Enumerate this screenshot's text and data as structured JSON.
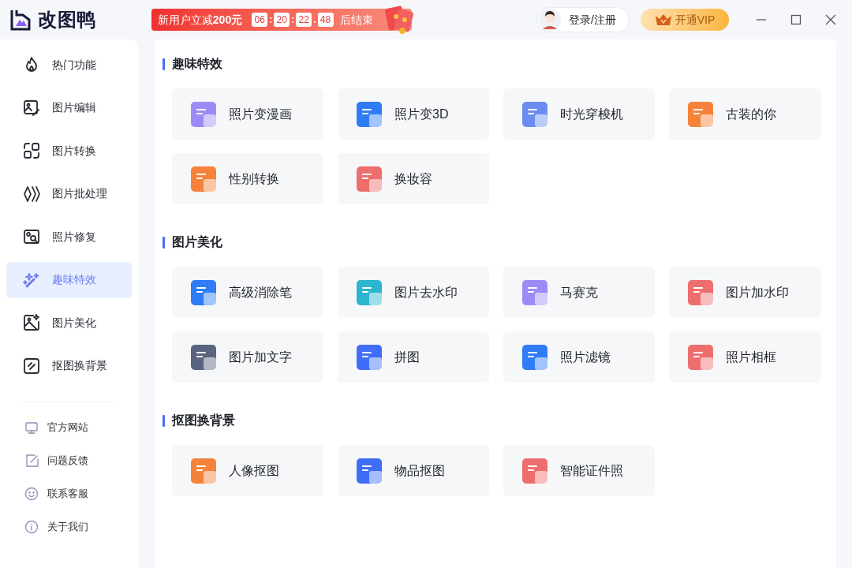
{
  "app": {
    "name": "改图鸭"
  },
  "promo": {
    "text": "新用户立减**200元**",
    "countdown": [
      "06",
      "20",
      "22",
      "48"
    ],
    "separators": [
      ":",
      ":",
      "."
    ],
    "suffix": "后结束"
  },
  "login": {
    "label": "登录/注册"
  },
  "vip": {
    "label": "开通VIP"
  },
  "sidebar": {
    "items": [
      {
        "label": "热门功能",
        "selected": false
      },
      {
        "label": "图片编辑",
        "selected": false
      },
      {
        "label": "图片转换",
        "selected": false
      },
      {
        "label": "图片批处理",
        "selected": false
      },
      {
        "label": "照片修复",
        "selected": false
      },
      {
        "label": "趣味特效",
        "selected": true
      },
      {
        "label": "图片美化",
        "selected": false
      },
      {
        "label": "抠图换背景",
        "selected": false
      }
    ],
    "footer": [
      {
        "label": "官方网站"
      },
      {
        "label": "问题反馈"
      },
      {
        "label": "联系客服"
      },
      {
        "label": "关于我们"
      }
    ]
  },
  "sections": [
    {
      "title": "趣味特效",
      "tools": [
        {
          "label": "照片变漫画",
          "color": "#9b8cf5"
        },
        {
          "label": "照片变3D",
          "color": "#2f7cf6"
        },
        {
          "label": "时光穿梭机",
          "color": "#6c8cf0"
        },
        {
          "label": "古装的你",
          "color": "#f5823a"
        },
        {
          "label": "性别转换",
          "color": "#f5823a"
        },
        {
          "label": "换妆容",
          "color": "#ee6e6e"
        }
      ]
    },
    {
      "title": "图片美化",
      "tools": [
        {
          "label": "高级消除笔",
          "color": "#2f7cf6"
        },
        {
          "label": "图片去水印",
          "color": "#2bb5cf"
        },
        {
          "label": "马赛克",
          "color": "#9b8cf5"
        },
        {
          "label": "图片加水印",
          "color": "#ee6e6e"
        },
        {
          "label": "图片加文字",
          "color": "#5a6380"
        },
        {
          "label": "拼图",
          "color": "#3f6df5"
        },
        {
          "label": "照片滤镜",
          "color": "#2f7cf6"
        },
        {
          "label": "照片相框",
          "color": "#ee6e6e"
        }
      ]
    },
    {
      "title": "抠图换背景",
      "tools": [
        {
          "label": "人像抠图",
          "color": "#f5823a"
        },
        {
          "label": "物品抠图",
          "color": "#3f6df5"
        },
        {
          "label": "智能证件照",
          "color": "#ee6e6e"
        }
      ]
    }
  ]
}
